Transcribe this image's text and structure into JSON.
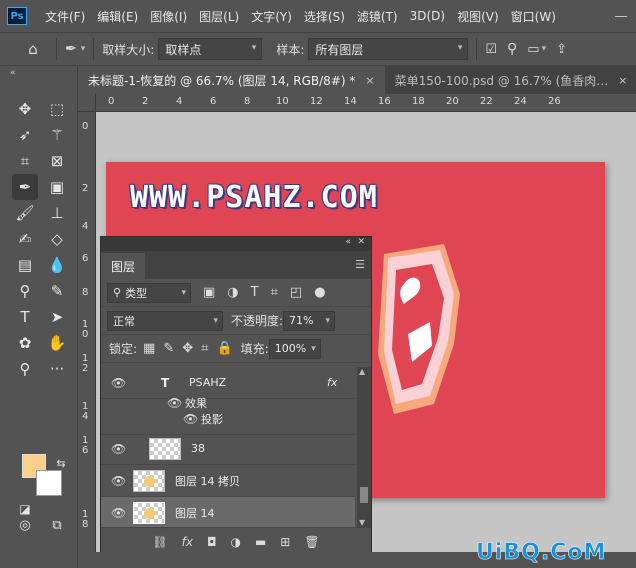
{
  "menubar": {
    "logo": "Ps",
    "items": [
      "文件(F)",
      "编辑(E)",
      "图像(I)",
      "图层(L)",
      "文字(Y)",
      "选择(S)",
      "滤镜(T)",
      "3D(D)",
      "视图(V)",
      "窗口(W)"
    ],
    "win_controls": [
      "—",
      "□",
      "✕"
    ]
  },
  "options": {
    "sample_size_label": "取样大小:",
    "sample_size_value": "取样点",
    "sample_label": "样本:",
    "sample_value": "所有图层"
  },
  "tabs": [
    {
      "label": "未标题-1-恢复的 @ 66.7% (图层 14, RGB/8#) *",
      "close": "×"
    },
    {
      "label": "菜单150-100.psd @ 16.7% (鱼香肉…",
      "close": "×"
    }
  ],
  "ruler": {
    "top": [
      "0",
      "2",
      "4",
      "6",
      "8",
      "10",
      "12",
      "14",
      "16",
      "18",
      "20",
      "22",
      "24",
      "26"
    ],
    "left": [
      [
        "0"
      ],
      [
        "2"
      ],
      [
        "4"
      ],
      [
        "6"
      ],
      [
        "8"
      ],
      [
        "1",
        "0"
      ],
      [
        "1",
        "2"
      ],
      [
        "1",
        "4"
      ],
      [
        "1",
        "6"
      ],
      [
        "1",
        "8"
      ]
    ]
  },
  "artboard": {
    "text": "WWW.PSAHZ.COM",
    "bg_color": "#e04553"
  },
  "colors": {
    "foreground": "#fcd08c",
    "background": "#ffffff"
  },
  "layers_panel": {
    "tab": "图层",
    "filter_type": "类型",
    "blend_mode": "正常",
    "opacity_label": "不透明度:",
    "opacity_value": "71%",
    "lock_label": "锁定:",
    "fill_label": "填充:",
    "fill_value": "100%",
    "layers": [
      {
        "name": "PSAHZ",
        "fx": "fx",
        "kind": "text"
      },
      {
        "name": "效果",
        "kind": "effects"
      },
      {
        "name": "投影",
        "kind": "effect-item"
      },
      {
        "name": "38",
        "kind": "pixel"
      },
      {
        "name": "图层 14 拷贝",
        "kind": "pixel"
      },
      {
        "name": "图层 14",
        "kind": "pixel",
        "selected": true
      }
    ]
  },
  "watermark": "UiBQ.CoM"
}
